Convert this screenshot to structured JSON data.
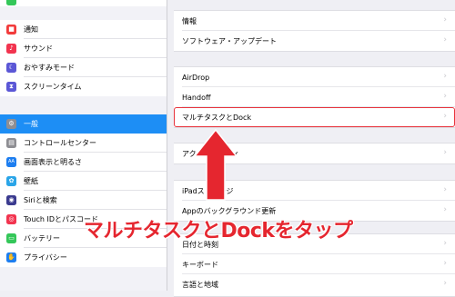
{
  "sidebar": {
    "top_stub": {
      "icon": "green-icon",
      "color": "#34c759"
    },
    "group1": [
      {
        "label": "通知",
        "icon": "notifications-icon",
        "glyph": "■",
        "color": "#f23b3b"
      },
      {
        "label": "サウンド",
        "icon": "sounds-icon",
        "glyph": "♪",
        "color": "#f2344f"
      },
      {
        "label": "おやすみモード",
        "icon": "moon-icon",
        "glyph": "☾",
        "color": "#5b57d6"
      },
      {
        "label": "スクリーンタイム",
        "icon": "hourglass-icon",
        "glyph": "⧗",
        "color": "#5b57d6"
      }
    ],
    "group2": [
      {
        "label": "一般",
        "icon": "gear-icon",
        "glyph": "⚙",
        "color": "#8e8e93",
        "selected": true
      },
      {
        "label": "コントロールセンター",
        "icon": "control-center-icon",
        "glyph": "▤",
        "color": "#8e8e93"
      },
      {
        "label": "画面表示と明るさ",
        "icon": "display-icon",
        "glyph": "AA",
        "color": "#1d7ef0"
      },
      {
        "label": "壁紙",
        "icon": "wallpaper-icon",
        "glyph": "✿",
        "color": "#2aa5e8"
      },
      {
        "label": "Siriと検索",
        "icon": "siri-icon",
        "glyph": "◉",
        "color": "#3b3b8f"
      },
      {
        "label": "Touch IDとパスコード",
        "icon": "fingerprint-icon",
        "glyph": "◎",
        "color": "#f2344f"
      },
      {
        "label": "バッテリー",
        "icon": "battery-icon",
        "glyph": "▭",
        "color": "#34c759"
      },
      {
        "label": "プライバシー",
        "icon": "hand-icon",
        "glyph": "✋",
        "color": "#1d7ef0"
      }
    ]
  },
  "main": {
    "group1": [
      "情報",
      "ソフトウェア・アップデート"
    ],
    "group2": [
      "AirDrop",
      "Handoff",
      "マルチタスクとDock"
    ],
    "group3": [
      "アクセシビリティ"
    ],
    "group4": [
      "iPadストレージ",
      "Appのバックグラウンド更新"
    ],
    "group5": [
      "日付と時刻",
      "キーボード",
      "言語と地域"
    ]
  },
  "annotation": {
    "text": "マルチタスクとDockをタップ",
    "color": "#e5262f"
  }
}
